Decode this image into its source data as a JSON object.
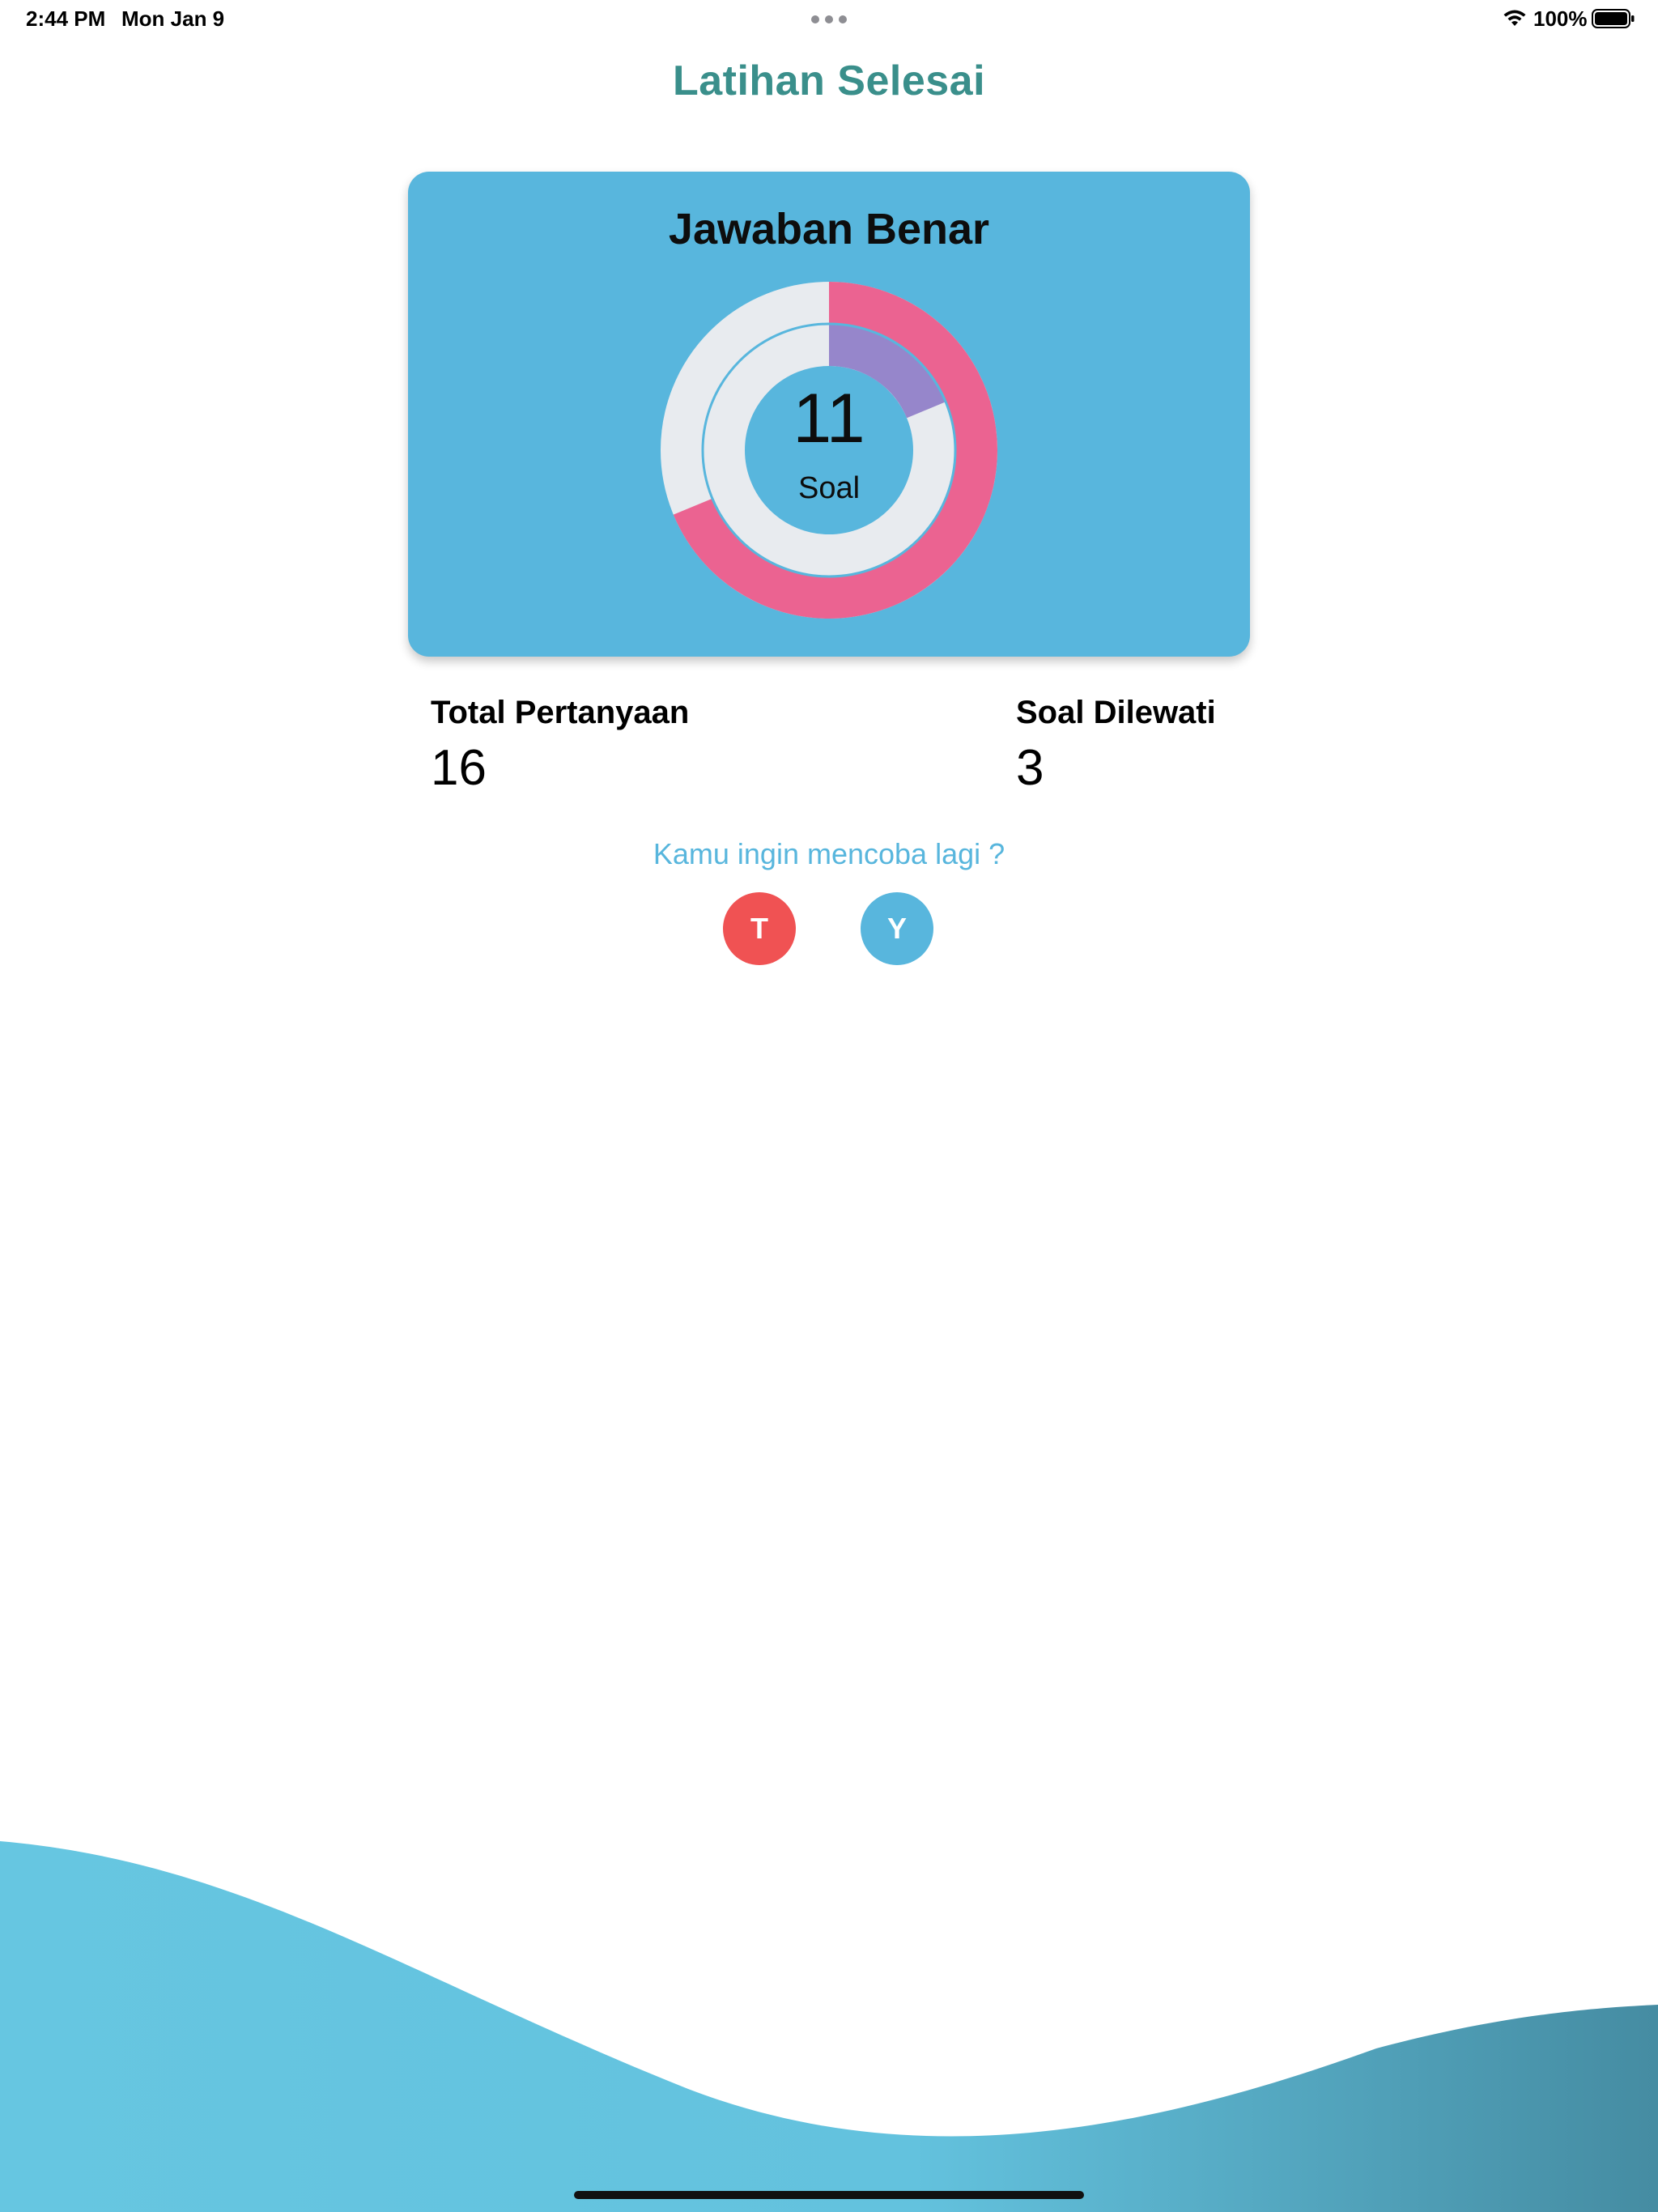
{
  "status_bar": {
    "time": "2:44 PM",
    "date": "Mon Jan 9",
    "battery": "100%"
  },
  "page": {
    "title": "Latihan Selesai"
  },
  "result_card": {
    "title": "Jawaban Benar",
    "count": "11",
    "unit": "Soal"
  },
  "stats": {
    "total_label": "Total Pertanyaan",
    "total_value": "16",
    "skipped_label": "Soal Dilewati",
    "skipped_value": "3"
  },
  "retry": {
    "prompt": "Kamu ingin mencoba lagi ?",
    "no_label": "T",
    "yes_label": "Y"
  },
  "chart_data": {
    "type": "pie",
    "rings": [
      {
        "value": 11,
        "max": 16,
        "color": "#eb6391",
        "track_color": "#e8ebef"
      },
      {
        "value": 3,
        "max": 16,
        "color": "#9686cb",
        "track_color": "#e8ebef"
      }
    ]
  },
  "colors": {
    "title": "#3a8f8b",
    "card": "#58b6dd",
    "no_button": "#f05253",
    "yes_button": "#58b6dd",
    "wave_light": "#66c6e1",
    "wave_dark": "#458ca2"
  },
  "icons": {
    "wifi": "wifi-icon",
    "battery": "battery-icon",
    "multitask": "more-dots-icon"
  }
}
